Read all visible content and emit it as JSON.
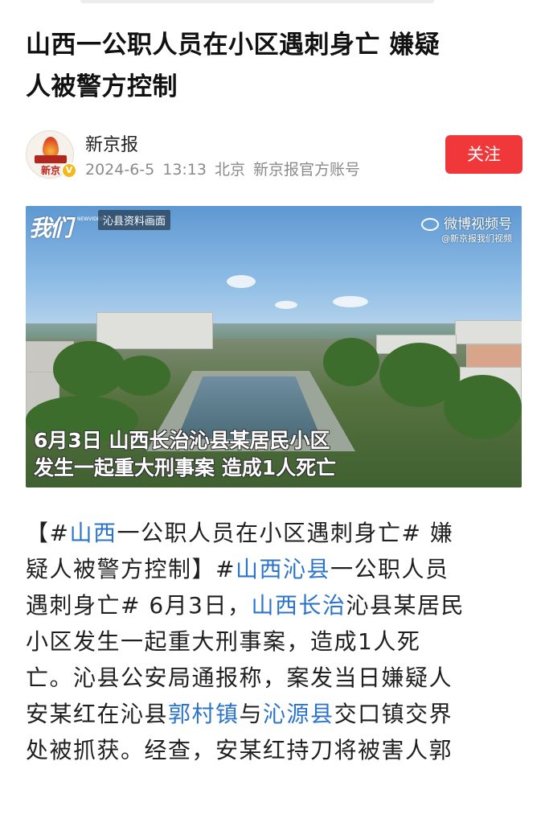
{
  "article": {
    "title_line1": "山西一公职人员在小区遇刺身亡 嫌疑",
    "title_line2": "人被警方控制"
  },
  "author": {
    "name": "新京报",
    "avatar_text": "新京",
    "verified_badge": "V",
    "date": "2024-6-5",
    "time": "13:13",
    "location": "北京",
    "account_type": "新京报官方账号",
    "follow_label": "关注"
  },
  "video": {
    "logo": "我们",
    "logo_sub": "NEWVIDEO",
    "tag": "沁县资料画面",
    "platform": "微博视频号",
    "platform_sub": "@新京报我们视频",
    "caption_line1": "6月3日 山西长治沁县某居民小区",
    "caption_line2": "发生一起重大刑事案 造成1人死亡"
  },
  "body": {
    "l1a": "【#",
    "l1link": "山西",
    "l1b": "一公职人员在小区遇刺身亡# 嫌",
    "l2a": "疑人被警方控制】#",
    "l2link": "山西沁县",
    "l2b": "一公职人员",
    "l3a": "遇刺身亡# 6月3日，",
    "l3link": "山西长治",
    "l3b": "沁县某居民",
    "l4": "小区发生一起重大刑事案，造成1人死",
    "l5": "亡。沁县公安局通报称，案发当日嫌疑人",
    "l6a": "安某红在沁县",
    "l6link1": "郭村镇",
    "l6b": "与",
    "l6link2": "沁源县",
    "l6c": "交口镇交界",
    "l7": "处被抓获。经查，安某红持刀将被害人郭"
  },
  "colors": {
    "accent_red": "#f0383a",
    "link_blue": "#2c74c9",
    "meta_gray": "#8a8a8a"
  }
}
